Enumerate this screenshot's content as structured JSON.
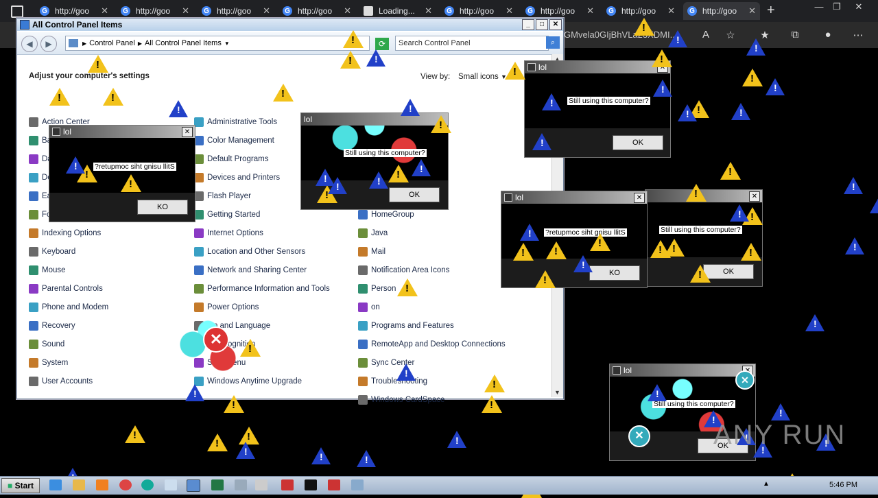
{
  "browser": {
    "tabs": [
      {
        "label": "http://goo"
      },
      {
        "label": "http://goo"
      },
      {
        "label": "http://goo"
      },
      {
        "label": "http://goo"
      },
      {
        "label": "Loading..."
      },
      {
        "label": "http://goo"
      },
      {
        "label": "http://goo"
      },
      {
        "label": "http://goo"
      },
      {
        "label": "http://goo"
      }
    ],
    "url_fragment": "GMvela0GIjBhVLa23XDMI..."
  },
  "control_panel": {
    "title": "All Control Panel Items",
    "breadcrumb": [
      "Control Panel",
      "All Control Panel Items"
    ],
    "search_placeholder": "Search Control Panel",
    "heading": "Adjust your computer's settings",
    "view_by_label": "View by:",
    "view_by_value": "Small icons",
    "items": [
      "Action Center",
      "Administrative Tools",
      "Color Management",
      "Default Programs",
      "Devices and Printers",
      "Flash Player",
      "Getting Started",
      "HomeGroup",
      "Indexing Options",
      "Internet Options",
      "Java",
      "Keyboard",
      "Location and Other Sensors",
      "Mail",
      "Mouse",
      "Network and Sharing Center",
      "Notification Area Icons",
      "Parental Controls",
      "Performance Information and Tools",
      "Personalization",
      "Phone and Modem",
      "Power Options",
      "Programs and Features",
      "Recovery",
      "Region and Language",
      "RemoteApp and Desktop Connections",
      "Sound",
      "Speech Recognition",
      "Sync Center",
      "System",
      "Start Menu",
      "Troubleshooting",
      "User Accounts",
      "Windows Anytime Upgrade",
      "Windows CardSpace"
    ],
    "visible_items": {
      "c1": [
        "Action Center",
        "Ba",
        "Da",
        "De",
        "Ea",
        "Fo",
        "Indexing Options",
        "Keyboard",
        "Mouse",
        "Parental Controls",
        "Phone and Modem",
        "Recovery",
        "Sound",
        "System",
        "User Accounts"
      ],
      "c2": [
        "Administrative Tools",
        "Color Management",
        "Default Programs",
        "Devices and Printers",
        "Flash Player",
        "Getting Started",
        "Internet Options",
        "Location and Other Sensors",
        "Network and Sharing Center",
        "Performance Information and Tools",
        "Power Options",
        "ion and Language",
        "h Recognition",
        "Start Menu",
        "Windows Anytime Upgrade"
      ],
      "c3": [
        "HomeGroup",
        "Java",
        "Mail",
        "Notification Area Icons",
        "Person",
        "on",
        "Programs and Features",
        "RemoteApp and Desktop Connections",
        "Sync Center",
        "Troubleshooting",
        "Windows CardSpace"
      ]
    }
  },
  "popups": [
    {
      "title": "lol",
      "message": "?retupmoc siht gnisu llitS",
      "button": "KO"
    },
    {
      "title": "lol",
      "message": "Still using this computer?",
      "button": "OK"
    },
    {
      "title": "lol",
      "message": "Still using this computer?",
      "button": "OK"
    },
    {
      "title": "lol",
      "message": "?retupmoc siht gnisu llitS",
      "button": "KO"
    },
    {
      "title": "",
      "message": "Still using this computer?",
      "button": "OK"
    },
    {
      "title": "lol",
      "message": "Still using this computer?",
      "button": "OK"
    }
  ],
  "taskbar": {
    "start_label": "Start",
    "clock": "5:46 PM"
  },
  "watermark": "ANY RUN",
  "colors": {
    "warning": "#f2c21b",
    "info": "#2140c8",
    "error": "#d33333",
    "taskbar": "#b3c4d8"
  }
}
